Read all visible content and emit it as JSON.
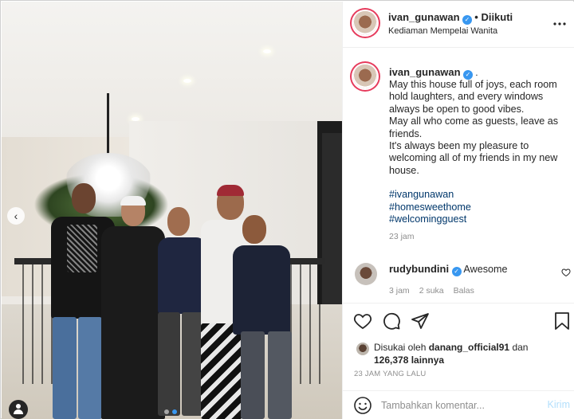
{
  "post": {
    "username": "ivan_gunawan",
    "follow_status": "Diikuti",
    "location": "Kediaman Mempelai Wanita",
    "caption_dot": ".",
    "caption_lines": [
      "May this house full of joys, each room hold laughters, and every windows always be open to good vibes.",
      "May all who come as guests, leave as friends.",
      "It's always been my pleasure to welcoming all of my friends in my new house."
    ],
    "hashtags": [
      "#ivangunawan",
      "#homesweethome",
      "#welcomingguest"
    ],
    "caption_time": "23 jam"
  },
  "comment": {
    "username": "rudybundini",
    "text": "Awesome",
    "time": "3 jam",
    "likes": "2 suka",
    "reply": "Balas"
  },
  "likes": {
    "prefix": "Disukai oleh",
    "liker": "danang_official91",
    "connector": "dan",
    "others": "126,378 lainnya"
  },
  "post_time": "23 JAM YANG LALU",
  "composer": {
    "placeholder": "Tambahkan komentar...",
    "submit": "Kirim"
  },
  "icons": {
    "more": "more-horizontal-icon",
    "like": "heart-icon",
    "comment": "speech-bubble-icon",
    "share": "paper-plane-icon",
    "save": "bookmark-icon",
    "emoji": "smiley-icon",
    "carousel_prev": "chevron-left-icon",
    "tags": "user-tag-icon"
  },
  "colors": {
    "accent": "#3897f0",
    "hashtag": "#00376b",
    "story_ring": "#e63b5c",
    "muted": "#8e8e8e"
  }
}
